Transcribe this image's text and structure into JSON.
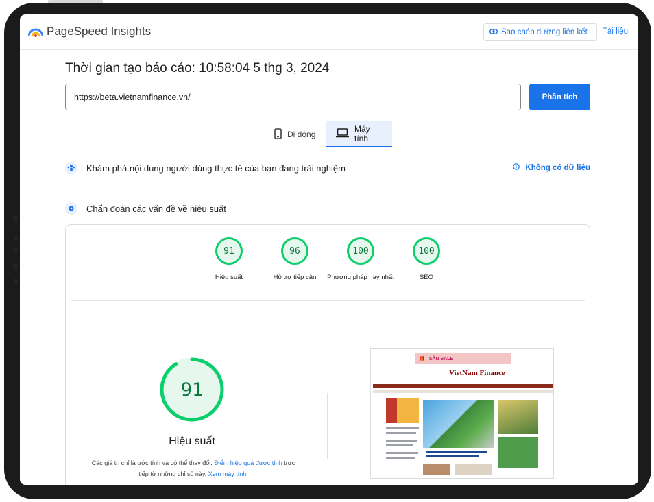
{
  "app": {
    "brand": "PageSpeed Insights",
    "copy_link_label": "Sao chép đường liên kết",
    "docs_label": "Tài liệu"
  },
  "report": {
    "time_label": "Thời gian tạo báo cáo: 10:58:04 5 thg 3, 2024",
    "url": "https://beta.vietnamfinance.vn/",
    "analyze_label": "Phân tích"
  },
  "tabs": [
    {
      "label": "Di động",
      "icon": "smartphone-icon",
      "selected": false
    },
    {
      "label": "Máy tính",
      "icon": "laptop-icon",
      "selected": true
    }
  ],
  "crux": {
    "text": "Khám phá nội dung người dùng thực tế của bạn đang trải nghiệm",
    "status": "Không có dữ liệu"
  },
  "diagnose": {
    "text": "Chẩn đoán các vấn đề về hiệu suất"
  },
  "scores": [
    {
      "value": "91",
      "label": "Hiệu suất"
    },
    {
      "value": "96",
      "label": "Hỗ trợ tiếp cận"
    },
    {
      "value": "100",
      "label": "Phương pháp hay nhất"
    },
    {
      "value": "100",
      "label": "SEO"
    }
  ],
  "performance": {
    "score": "91",
    "score_fraction": 0.91,
    "title": "Hiệu suất",
    "desc_prefix": "Các giá trị chỉ là ước tính và có thể thay đổi.",
    "desc_link1": "Điểm hiệu quả được tính",
    "desc_middle": "trực tiếp từ những chỉ số này.",
    "desc_link2": "Xem máy tính."
  },
  "screenshot": {
    "ad_text": "SĂN SALE",
    "site_name": "VietNam Finance"
  },
  "colors": {
    "accent": "#1a73e8",
    "pass_green": "#0cce6b",
    "pass_bg": "#e6f7ee",
    "pass_text": "#0a7a3c"
  }
}
